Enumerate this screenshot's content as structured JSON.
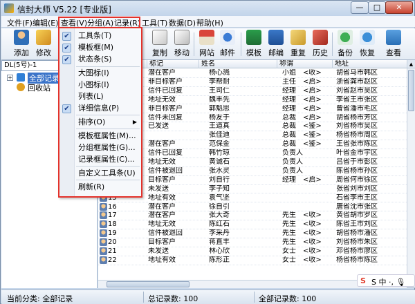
{
  "window": {
    "title": "信封大师 V5.22 [专业版]",
    "min_label": "—",
    "max_label": "□",
    "close_label": "✕"
  },
  "menubar": [
    {
      "label": "文件(F)"
    },
    {
      "label": "编辑(E)"
    },
    {
      "label": "查看(V)"
    },
    {
      "label": "分组(A)"
    },
    {
      "label": "记录(R)"
    },
    {
      "label": "工具(T)"
    },
    {
      "label": "数据(D)"
    },
    {
      "label": "帮助(H)"
    }
  ],
  "toolbar": {
    "add": "添加",
    "edit": "修改",
    "copy": "复制",
    "move": "移动",
    "website": "网站",
    "mail": "邮件",
    "template": "模板",
    "postal": "邮编",
    "duplicate": "重复",
    "history": "历史",
    "backup": "备份",
    "restore": "恢复",
    "view": "查看"
  },
  "left_pane": {
    "address": "DL(5号)-1",
    "tree": [
      {
        "label": "全部记录",
        "selected": true
      },
      {
        "label": "回收站",
        "selected": false
      }
    ]
  },
  "grid": {
    "headers": [
      "标记",
      "姓名",
      "称谓",
      "地址"
    ],
    "rows": [
      {
        "num": "",
        "mark": "潜在客户",
        "name": "杨心溅",
        "title": "小姐",
        "tag": "<收>",
        "addr": "胡省马市韩区"
      },
      {
        "num": "",
        "mark": "非目标客户",
        "name": "李帮耐",
        "title": "主任",
        "tag": "<启>",
        "addr": "浙省龚市赵区"
      },
      {
        "num": "",
        "mark": "信件已回复",
        "name": "王司仁",
        "title": "经理",
        "tag": "<启>",
        "addr": "刘省赵市吴区"
      },
      {
        "num": "",
        "mark": "地址无效",
        "name": "魏丰先",
        "title": "经理",
        "tag": "<启>",
        "addr": "李省王市张区"
      },
      {
        "num": "",
        "mark": "非目标客户",
        "name": "郭魁思",
        "title": "经理",
        "tag": "<启>",
        "addr": "曾省潘市毛区"
      },
      {
        "num": "",
        "mark": "信件未回复",
        "name": "杨友于",
        "title": "总裁",
        "tag": "<启>",
        "addr": "胡省杨市芳区"
      },
      {
        "num": "",
        "mark": "已发送",
        "name": "王道真",
        "title": "总裁",
        "tag": "<鉴>",
        "addr": "刘省杨市吴区"
      },
      {
        "num": "",
        "mark": "",
        "name": "张佳迪",
        "title": "总裁",
        "tag": "<鉴>",
        "addr": "杨省杨市周区"
      },
      {
        "num": "",
        "mark": "潜在客户",
        "name": "范保金",
        "title": "总裁",
        "tag": "<鉴>",
        "addr": "王省张市陈区"
      },
      {
        "num": "",
        "mark": "信件已回复",
        "name": "韩竹琼",
        "title": "负责人",
        "tag": "",
        "addr": "叶省金市宇区"
      },
      {
        "num": "",
        "mark": "地址无效",
        "name": "黄诚石",
        "title": "负责人",
        "tag": "",
        "addr": "吕省于市彭区"
      },
      {
        "num": "",
        "mark": "信件被退回",
        "name": "张水灵",
        "title": "负责人",
        "tag": "",
        "addr": "陈省杨市孙区"
      },
      {
        "num": "",
        "mark": "目标客户",
        "name": "刘自行",
        "title": "经理",
        "tag": "<启>",
        "addr": "周省何市徐区"
      },
      {
        "num": "",
        "mark": "未发送",
        "name": "李子知",
        "title": "",
        "tag": "",
        "addr": "张省刘市刘区"
      },
      {
        "num": "15",
        "mark": "地址有效",
        "name": "袁气坚",
        "title": "",
        "tag": "",
        "addr": "石省李市王区"
      },
      {
        "num": "16",
        "mark": "潜在客户",
        "name": "徐自引",
        "title": "",
        "tag": "",
        "addr": "唐省沈市张区"
      },
      {
        "num": "17",
        "mark": "潜在客户",
        "name": "张大奇",
        "title": "先生",
        "tag": "<收>",
        "addr": "黄省胡市罗区"
      },
      {
        "num": "18",
        "mark": "地址无效",
        "name": "陈红石",
        "title": "先生",
        "tag": "<收>",
        "addr": "陈省王市刘区"
      },
      {
        "num": "19",
        "mark": "信件被退回",
        "name": "李采丹",
        "title": "先生",
        "tag": "<收>",
        "addr": "胡省杨市潘区"
      },
      {
        "num": "20",
        "mark": "目标客户",
        "name": "蒋直丰",
        "title": "先生",
        "tag": "<收>",
        "addr": "刘省杨市朱区"
      },
      {
        "num": "21",
        "mark": "未发送",
        "name": "林心欣",
        "title": "女士",
        "tag": "<收>",
        "addr": "邓省杨市廖区"
      },
      {
        "num": "22",
        "mark": "地址有效",
        "name": "陈形正",
        "title": "女士",
        "tag": "<收>",
        "addr": "杨省杨市陈区"
      }
    ]
  },
  "dropdown": {
    "items": [
      {
        "label": "工具条(T)",
        "checked": true
      },
      {
        "label": "模板框(M)",
        "checked": true
      },
      {
        "label": "状态条(S)",
        "checked": true
      },
      {
        "label": "大图标(I)",
        "checked": false
      },
      {
        "label": "小图标(I)",
        "checked": false
      },
      {
        "label": "列表(L)",
        "checked": false
      },
      {
        "label": "详细信息(P)",
        "checked": true
      },
      {
        "label": "排序(O)",
        "checked": false,
        "submenu": true
      },
      {
        "label": "模板框属性(M)...",
        "checked": false
      },
      {
        "label": "分组框属性(G)...",
        "checked": false
      },
      {
        "label": "记录框属性(C)...",
        "checked": false
      },
      {
        "label": "自定义工具条(U)",
        "checked": false
      },
      {
        "label": "刷新(R)",
        "checked": false
      }
    ]
  },
  "status": {
    "category": "当前分类: 全部记录",
    "total": "总记录数: 100",
    "all_total": "全部记录数: 100"
  },
  "ime": {
    "label": "S 中 ·, 🎙"
  }
}
